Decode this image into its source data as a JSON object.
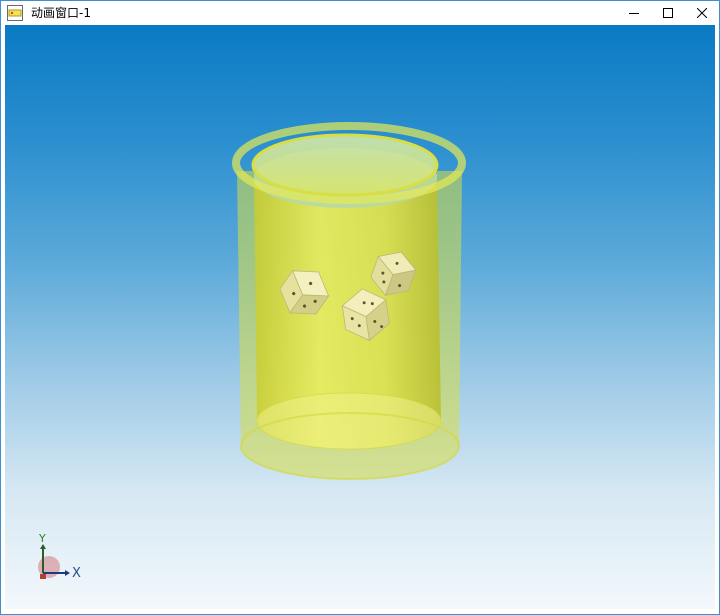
{
  "window": {
    "title": "动画窗口-1",
    "icon": "app-icon"
  },
  "controls": {
    "minimize_icon": "minimize-icon",
    "maximize_icon": "maximize-icon",
    "close_icon": "close-icon"
  },
  "viewport": {
    "background_top": "#0a7ac4",
    "background_bottom": "#f3f8fc",
    "cup_color": "#e6ea3a",
    "dice_color": "#ece9a8",
    "dice_count": 3
  },
  "axes": {
    "x_label": "X",
    "y_label": "Y"
  }
}
